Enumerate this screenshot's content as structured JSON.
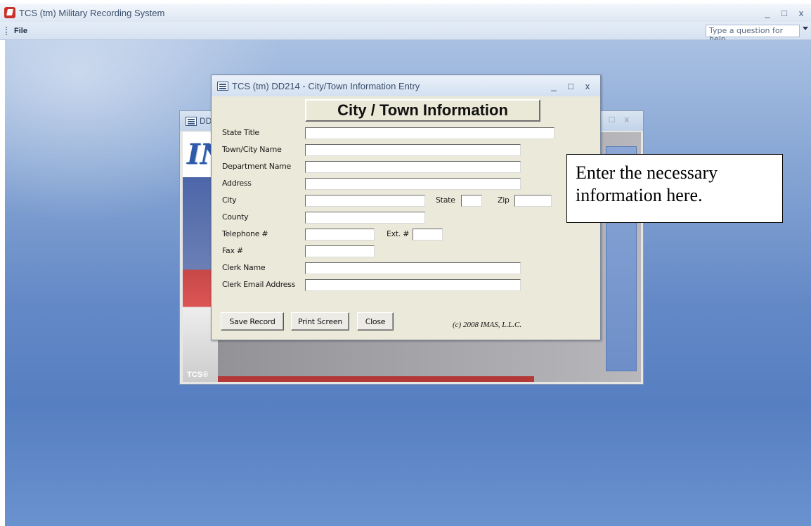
{
  "app": {
    "title": "TCS (tm) Military Recording System",
    "window_controls": {
      "minimize": "_",
      "maximize": "□",
      "close": "x"
    }
  },
  "menubar": {
    "file_label": "File",
    "help_placeholder": "Type a question for help"
  },
  "background_form": {
    "title_fragment": "DD",
    "logo_text": "IN",
    "footer_text": "TCS®"
  },
  "dialog": {
    "title": "TCS (tm) DD214 - City/Town Information Entry",
    "heading": "City / Town Information",
    "fields": {
      "state_title": {
        "label": "State Title",
        "value": ""
      },
      "town_city_name": {
        "label": "Town/City Name",
        "value": ""
      },
      "department_name": {
        "label": "Department Name",
        "value": ""
      },
      "address": {
        "label": "Address",
        "value": ""
      },
      "city": {
        "label": "City",
        "value": ""
      },
      "state": {
        "label": "State",
        "value": ""
      },
      "zip": {
        "label": "Zip",
        "value": ""
      },
      "county": {
        "label": "County",
        "value": ""
      },
      "telephone": {
        "label": "Telephone #",
        "value": ""
      },
      "ext": {
        "label": "Ext. #",
        "value": ""
      },
      "fax": {
        "label": "Fax #",
        "value": ""
      },
      "clerk_name": {
        "label": "Clerk Name",
        "value": ""
      },
      "clerk_email": {
        "label": "Clerk Email Address",
        "value": ""
      }
    },
    "buttons": {
      "save": "Save Record",
      "print": "Print Screen",
      "close": "Close"
    },
    "copyright": "(c) 2008 IMAS, L.L.C."
  },
  "callout": {
    "text": "Enter the necessary information here."
  }
}
